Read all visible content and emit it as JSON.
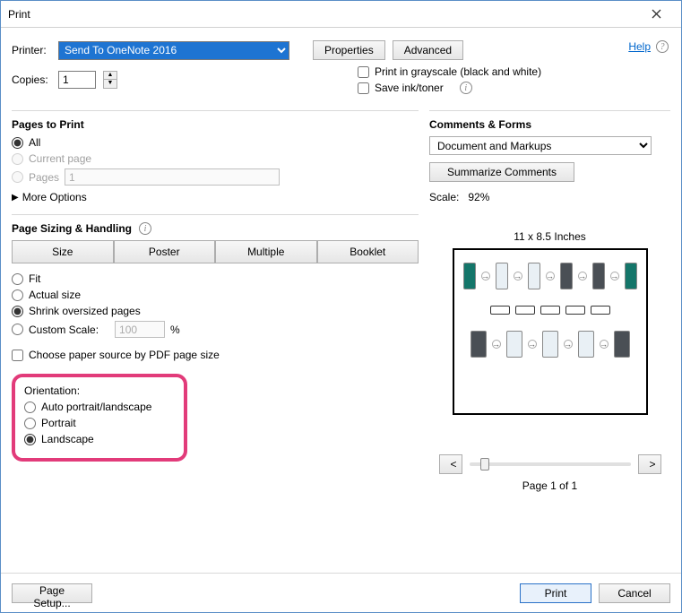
{
  "window": {
    "title": "Print"
  },
  "printer": {
    "label": "Printer:",
    "selected": "Send To OneNote 2016",
    "properties_btn": "Properties",
    "advanced_btn": "Advanced"
  },
  "help": {
    "label": "Help"
  },
  "copies": {
    "label": "Copies:",
    "value": "1"
  },
  "options": {
    "grayscale": "Print in grayscale (black and white)",
    "save_ink": "Save ink/toner"
  },
  "pages_to_print": {
    "title": "Pages to Print",
    "all": "All",
    "current": "Current page",
    "pages": "Pages",
    "pages_value": "1",
    "more_options": "More Options"
  },
  "sizing": {
    "title": "Page Sizing & Handling",
    "size": "Size",
    "poster": "Poster",
    "multiple": "Multiple",
    "booklet": "Booklet",
    "fit": "Fit",
    "actual": "Actual size",
    "shrink": "Shrink oversized pages",
    "custom": "Custom Scale:",
    "custom_value": "100",
    "percent": "%",
    "choose_paper": "Choose paper source by PDF page size"
  },
  "orientation": {
    "title": "Orientation:",
    "auto": "Auto portrait/landscape",
    "portrait": "Portrait",
    "landscape": "Landscape"
  },
  "comments": {
    "title": "Comments & Forms",
    "selected": "Document and Markups",
    "summarize": "Summarize Comments"
  },
  "scale": {
    "label": "Scale:",
    "value": "92%"
  },
  "preview": {
    "dims": "11 x 8.5 Inches",
    "page_of": "Page 1 of 1",
    "prev": "<",
    "next": ">"
  },
  "footer": {
    "page_setup": "Page Setup...",
    "print": "Print",
    "cancel": "Cancel"
  }
}
